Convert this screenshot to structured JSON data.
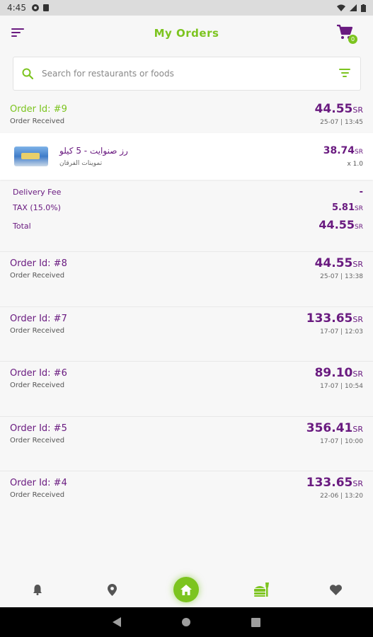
{
  "status_bar": {
    "time": "4:45"
  },
  "header": {
    "title": "My Orders",
    "cart_count": "0"
  },
  "search": {
    "placeholder": "Search for restaurants or foods"
  },
  "expanded_order": {
    "id": "Order Id: #9",
    "status": "Order Received",
    "amount": "44.55",
    "currency": "SR",
    "date": "25-07 | 13:45",
    "item": {
      "name": "رز صنوايت - 5 كيلو",
      "store": "تموينات الفرقان",
      "price": "38.74",
      "currency": "SR",
      "qty": "x 1.0"
    },
    "summary": {
      "delivery_label": "Delivery Fee",
      "delivery_value": "-",
      "tax_label": "TAX (15.0%)",
      "tax_value": "5.81",
      "total_label": "Total",
      "total_value": "44.55",
      "currency": "SR"
    }
  },
  "orders": [
    {
      "id": "Order Id: #8",
      "status": "Order Received",
      "amount": "44.55",
      "currency": "SR",
      "date": "25-07 | 13:38"
    },
    {
      "id": "Order Id: #7",
      "status": "Order Received",
      "amount": "133.65",
      "currency": "SR",
      "date": "17-07 | 12:03"
    },
    {
      "id": "Order Id: #6",
      "status": "Order Received",
      "amount": "89.10",
      "currency": "SR",
      "date": "17-07 | 10:54"
    },
    {
      "id": "Order Id: #5",
      "status": "Order Received",
      "amount": "356.41",
      "currency": "SR",
      "date": "17-07 | 10:00"
    },
    {
      "id": "Order Id: #4",
      "status": "Order Received",
      "amount": "133.65",
      "currency": "SR",
      "date": "22-06 | 13:20"
    }
  ],
  "bottom_nav": {
    "items": [
      "bell-icon",
      "location-pin-icon",
      "home-icon",
      "restaurant-icon",
      "heart-icon"
    ]
  },
  "colors": {
    "primary": "#6a1b80",
    "accent": "#7cc41f",
    "background": "#f7f7f7"
  }
}
